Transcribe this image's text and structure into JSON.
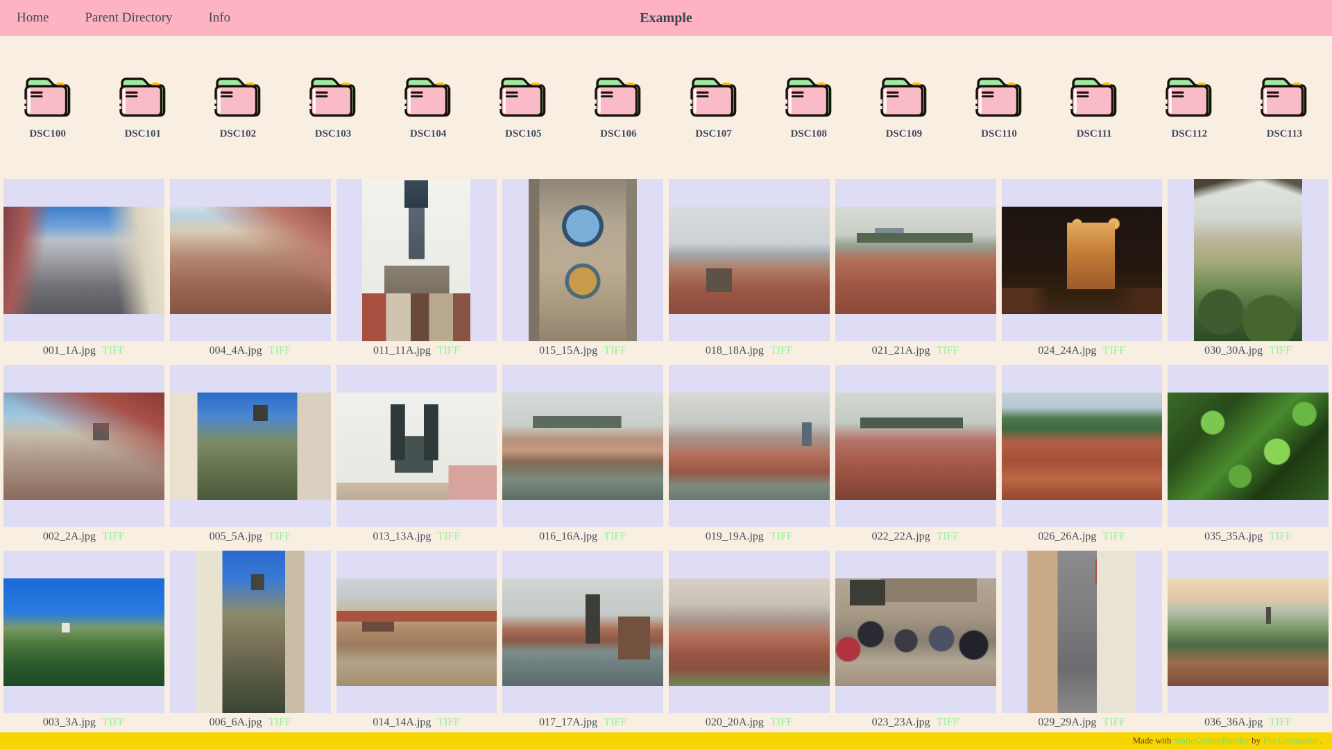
{
  "header": {
    "title": "Example",
    "bg": "#fdb3c2",
    "links": [
      {
        "label": "Home"
      },
      {
        "label": "Parent Directory"
      },
      {
        "label": "Info"
      }
    ]
  },
  "folders": {
    "items": [
      "DSC100",
      "DSC101",
      "DSC102",
      "DSC103",
      "DSC104",
      "DSC105",
      "DSC106",
      "DSC107",
      "DSC108",
      "DSC109",
      "DSC110",
      "DSC111",
      "DSC112",
      "DSC113"
    ],
    "icon": "folder-icon",
    "colors": {
      "body": "#f8bbc7",
      "tab": "#a0e9a3",
      "accent": "#ffbe0b",
      "outline": "#171209"
    }
  },
  "gallery": {
    "badge_color": "#8cf596",
    "cell_bg": "#dfddf6",
    "rows": [
      [
        {
          "file": "001_1A.jpg",
          "badge": "TIFF",
          "orientation": "landscape",
          "art": "linear-gradient(100deg,#7e4048 0%,#a85a58 13%,rgba(0,0,0,0) 27%),linear-gradient(262deg,#ece6d2 0%,#dcd4bd 16%,rgba(0,0,0,0) 33%),linear-gradient(180deg,#3f7ecc 0%,#72a4da 19%,#b9c2c8 31%,#9a9aa0 52%,#6e6e74 76%,#585860 100%)"
        },
        {
          "file": "004_4A.jpg",
          "badge": "TIFF",
          "orientation": "landscape",
          "art": "linear-gradient(215deg,#9e5148 0%,#bd7a6a 20%,rgba(0,0,0,0) 42%),linear-gradient(180deg,#cfe0ea 0%,#bcd0dd 9%,#d8cdb6 22%,#b48a74 46%,#9c6854 72%,#855443 100%)"
        },
        {
          "file": "011_11A.jpg",
          "badge": "TIFF",
          "orientation": "portrait",
          "art": "linear-gradient(#394a58,#2c3a46) 50% 1%/22% 17% no-repeat,linear-gradient(#5d6c78,#49565f) 50% 16%/15% 40% no-repeat,linear-gradient(90deg,#a85040 0 22%,#cfc5ae 22% 45%,#6b4a3e 45% 62%,#b8a98e 62% 84%,#8a5444 84%) 50% 101%/100% 30% no-repeat,linear-gradient(#8a8276,#6e6253) 50% 74%/60% 28% no-repeat,linear-gradient(180deg,#f2f2ee 0%,#e9e9e2 100%)"
        },
        {
          "file": "015_15A.jpg",
          "badge": "TIFF",
          "orientation": "portrait",
          "art": "radial-gradient(circle at 50% 29%,#7ab0d8 0 13%,#32506e 13% 16%,rgba(0,0,0,0) 16.6%),radial-gradient(circle at 50% 63%,#c89a4a 0 12%,#4c6a7a 12% 15%,rgba(0,0,0,0) 15.6%),linear-gradient(90deg,#7e7466 0 10%,rgba(0,0,0,0) 10% 90%,#8a8072 90%),linear-gradient(180deg,#8f8578 0%,#b3a791 28%,#bcab93 55%,#a8977f 80%,#93836e 100%)"
        },
        {
          "file": "018_18A.jpg",
          "badge": "TIFF",
          "orientation": "landscape",
          "art": "linear-gradient(#5c5248,#5c5248) 28% 74%/16% 22% no-repeat,linear-gradient(180deg,#d9dcdd 0%,#cbd1d4 34%,#a3a8ab 44%,#b07d66 58%,#9c5947 76%,#8a4a3c 100%)"
        },
        {
          "file": "021_21A.jpg",
          "badge": "TIFF",
          "orientation": "landscape",
          "art": "linear-gradient(#56654f,#56654f) 48% 27%/72% 9% no-repeat,linear-gradient(#7c8a94,#7c8a94) 30% 22%/18% 8% no-repeat,linear-gradient(180deg,#d6dbd6 0%,#c9cfc6 26%,#97a095 36%,#b26e57 50%,#a05844 72%,#8d4839 100%)"
        },
        {
          "file": "024_24A.jpg",
          "badge": "TIFF",
          "orientation": "landscape",
          "art": "linear-gradient(180deg,#e2a95e 0%,#c27c36 45%,#9e5a2a 100%) 58% 40%/30% 62% no-repeat,radial-gradient(circle at 47% 16%,#e8b668 0 3.5%,rgba(0,0,0,0) 4.5%),radial-gradient(circle at 70% 16%,#e8b668 0 3.5%,rgba(0,0,0,0) 4.5%),linear-gradient(90deg,#55301c 0 18%,rgba(0,0,0,0) 30% 70%,#4a2a18 85%) 50% 100%/100% 24% no-repeat,linear-gradient(180deg,#1d1410 0%,#241710 55%,#32200f 80%,#41281a 100%)"
        },
        {
          "file": "030_30A.jpg",
          "badge": "TIFF",
          "orientation": "portrait",
          "art": "linear-gradient(165deg,rgba(66,60,46,0.95) 0 5%,rgba(0,0,0,0) 11%),linear-gradient(200deg,rgba(66,60,46,0.85) 0 4%,rgba(0,0,0,0) 9%),radial-gradient(circle at 25% 82%,#3e5c30 0 14%,rgba(0,0,0,0) 15%),radial-gradient(circle at 70% 88%,#46662f 0 16%,rgba(0,0,0,0) 17%),linear-gradient(180deg,#e2e6e2 0%,#d2d8d2 24%,#bcb49a 38%,#a3a878 52%,#6a8a50 68%,#3e6034 85%,#2c4a26 100%)"
        }
      ],
      [
        {
          "file": "002_2A.jpg",
          "badge": "TIFF",
          "orientation": "landscape",
          "art": "linear-gradient(206deg,#8a3c36 0%,#a85048 20%,rgba(0,0,0,0) 46%),linear-gradient(#4c5a5c,#4c5a5c) 62% 34%/10% 16% no-repeat,linear-gradient(180deg,#7fb3d8 0%,#a6c6dc 24%,#c6beac 38%,#ae9688 62%,#8a6a5c 100%)"
        },
        {
          "file": "005_5A.jpg",
          "badge": "TIFF",
          "orientation": "landscape",
          "art": "linear-gradient(90deg,#e9e1cd 0 17%,rgba(0,0,0,0) 17% 79%,#d9d0c0 79%),linear-gradient(#3c3c34,#3c3c34) 57% 14%/9% 15% no-repeat,linear-gradient(180deg,#2a6cc8 0%,#4a86d0 22%,#7d8d69 45%,#687850 66%,#49593b 100%)"
        },
        {
          "file": "013_13A.jpg",
          "badge": "TIFF",
          "orientation": "landscape",
          "art": "linear-gradient(#2e3a3a,#2e3a3a) 37% 24%/9% 52% no-repeat,linear-gradient(#2e3a3a,#2e3a3a) 60% 24%/9% 52% no-repeat,linear-gradient(#46524f,#46524f) 48% 62%/24% 34% no-repeat,linear-gradient(90deg,rgba(0,0,0,0) 0 70%,#d6a49c 70%) 0 100%/100% 32% no-repeat,linear-gradient(#cdbda6,#bcab94) 0% 100%/70% 16% no-repeat,linear-gradient(180deg,#eff0ec 0%,#e7e7e0 100%)"
        },
        {
          "file": "016_16A.jpg",
          "badge": "TIFF",
          "orientation": "landscape",
          "art": "linear-gradient(#5d6a60,#5d6a60) 42% 25%/55% 11% no-repeat,linear-gradient(180deg,#d5dbd8 0%,#c8cfc9 30%,#b5917a 44%,#c79a7f 54%,#8a6a58 64%,#777763 72%,#7d8d80 80%,#5d6d62 100%)"
        },
        {
          "file": "019_19A.jpg",
          "badge": "TIFF",
          "orientation": "landscape",
          "art": "linear-gradient(#5a6a74,#5a6a74) 88% 36%/6% 22% no-repeat,linear-gradient(180deg,#d8d8d4 0%,#c6c9c6 28%,#a6958c 42%,#b3705a 58%,#985745 74%,#7d8a80 86%,#6a7a70 100%)"
        },
        {
          "file": "022_22A.jpg",
          "badge": "TIFF",
          "orientation": "landscape",
          "art": "linear-gradient(#4c5c50,#4c5c50) 44% 26%/64% 10% no-repeat,linear-gradient(180deg,#d2d8d2 0%,#c2cac2 28%,#b3746a 44%,#a65847 66%,#8d4a3b 86%,#7b4234 100%)"
        },
        {
          "file": "026_26A.jpg",
          "badge": "TIFF",
          "orientation": "landscape",
          "art": "linear-gradient(180deg,#c6d0d8 0%,#b7c7d1 14%,#4d7a4c 24%,#40693f 34%,#b35f48 46%,#a64f37 64%,#bd6747 80%,#94462f 100%)"
        },
        {
          "file": "035_35A.jpg",
          "badge": "TIFF",
          "orientation": "landscape",
          "art": "radial-gradient(circle at 28% 28%,#7cc84e 0 8%,rgba(0,0,0,0) 9%),radial-gradient(circle at 68% 55%,#8ad455 0 10%,rgba(0,0,0,0) 11%),radial-gradient(circle at 45% 78%,#5ea83c 0 9%,rgba(0,0,0,0) 10%),radial-gradient(circle at 85% 20%,#6ab844 0 7%,rgba(0,0,0,0) 8%),linear-gradient(135deg,#3a6a28 0%,#284a1a 28%,#498a2e 50%,#1d3a12 72%,#345f22 100%)"
        }
      ],
      [
        {
          "file": "003_3A.jpg",
          "badge": "TIFF",
          "orientation": "landscape",
          "art": "linear-gradient(#e6e6de,#e6e6de) 38% 46%/5% 9% no-repeat,linear-gradient(180deg,#1a6ad8 0%,#2a7ae0 32%,#7a9a68 46%,#4c7a3e 60%,#2c5a2e 80%,#1c4a22 100%)"
        },
        {
          "file": "006_6A.jpg",
          "badge": "TIFF",
          "orientation": "portrait",
          "art": "linear-gradient(90deg,#e8e2d0 0 24%,rgba(0,0,0,0) 24% 82%,#cabda6 82%),linear-gradient(#44443c,#44443c) 58% 16%/12% 10% no-repeat,linear-gradient(180deg,#2a6ad0 0%,#3a7ad4 18%,#8b8b6b 38%,#7b7359 56%,#5b5b45 76%,#3b4535 100%)"
        },
        {
          "file": "014_14A.jpg",
          "badge": "TIFF",
          "orientation": "landscape",
          "art": "linear-gradient(#a8543e,#a8543e) 50% 34%/100% 10% no-repeat,linear-gradient(#6a4a3a,#6a4a3a) 20% 42%/20% 14% no-repeat,linear-gradient(180deg,#cfd4d8 0%,#c3c9cd 16%,#c9b9a1 30%,#b18b6b 46%,#9b7b5d 62%,#b4a389 78%,#a3906f 100%)"
        },
        {
          "file": "017_17A.jpg",
          "badge": "TIFF",
          "orientation": "landscape",
          "art": "linear-gradient(#3c3c38,#3c3c38) 57% 28%/9% 46% no-repeat,linear-gradient(#72513f,#72513f) 90% 60%/20% 40% no-repeat,linear-gradient(180deg,#d2d5d2 0%,#c3c9c6 34%,#a86c55 48%,#8c5b47 58%,#7d8d8c 68%,#6b7b7c 84%,#5b6b6c 100%)"
        },
        {
          "file": "020_20A.jpg",
          "badge": "TIFF",
          "orientation": "landscape",
          "art": "linear-gradient(180deg,#d8cfc6 0%,#c9c0b6 24%,#a89a90 38%,#b3705a 54%,#9a5645 70%,#8a5242 84%,#6d8a58 100%)"
        },
        {
          "file": "023_23A.jpg",
          "badge": "TIFF",
          "orientation": "landscape",
          "art": "linear-gradient(#3c3c36,#3c3c36) 12% 2%/22% 24% no-repeat,linear-gradient(#8c7c6a,#8c7c6a) 70% 0%/60% 22% no-repeat,radial-gradient(circle at 22% 52%,#2a2a32 0 9%,rgba(0,0,0,0) 10%),radial-gradient(circle at 44% 58%,#3a3a44 0 10%,rgba(0,0,0,0) 11%),radial-gradient(circle at 66% 56%,#4a5263 0 10%,rgba(0,0,0,0) 11%),radial-gradient(circle at 86% 62%,#22222a 0 9%,rgba(0,0,0,0) 10%),radial-gradient(circle at 8% 66%,#b03440 0 7%,rgba(0,0,0,0) 8%),linear-gradient(180deg,#b3a896 0%,#a69884 34%,#887e72 58%,#b2a794 78%,#a18f7e 100%)"
        },
        {
          "file": "029_29A.jpg",
          "badge": "TIFF",
          "orientation": "portrait",
          "art": "linear-gradient(90deg,#c9a988 0 28%,rgba(0,0,0,0) 28% 64%,#e9e3d5 64%),linear-gradient(#a8503c,#a8503c) 95% 6%/34% 16% no-repeat,linear-gradient(#74402e,#74402e) 5% 2%/24% 10% no-repeat,linear-gradient(180deg,#8c8c8e 0%,#7c7c7e 42%,#6c6c70 72%,#8a8a88 100%)"
        },
        {
          "file": "036_36A.jpg",
          "badge": "TIFF",
          "orientation": "landscape",
          "art": "linear-gradient(#4c4c44,#4c4c44) 63% 32%/3% 16% no-repeat,linear-gradient(180deg,#ead9b8 0%,#e2c9a6 18%,#b7c1ae 30%,#7c9c6a 46%,#4c6c44 62%,#9c6c4e 78%,#8a5a42 92%,#7a4e3a 100%)"
        }
      ]
    ]
  },
  "footer": {
    "prefix": "Made with",
    "link1": "StaticGalleryBuilder",
    "middle": "by",
    "link2": "Flo Greistorfer",
    "suffix": ".",
    "bg": "#f6d500",
    "link_color": "#66e57a"
  }
}
